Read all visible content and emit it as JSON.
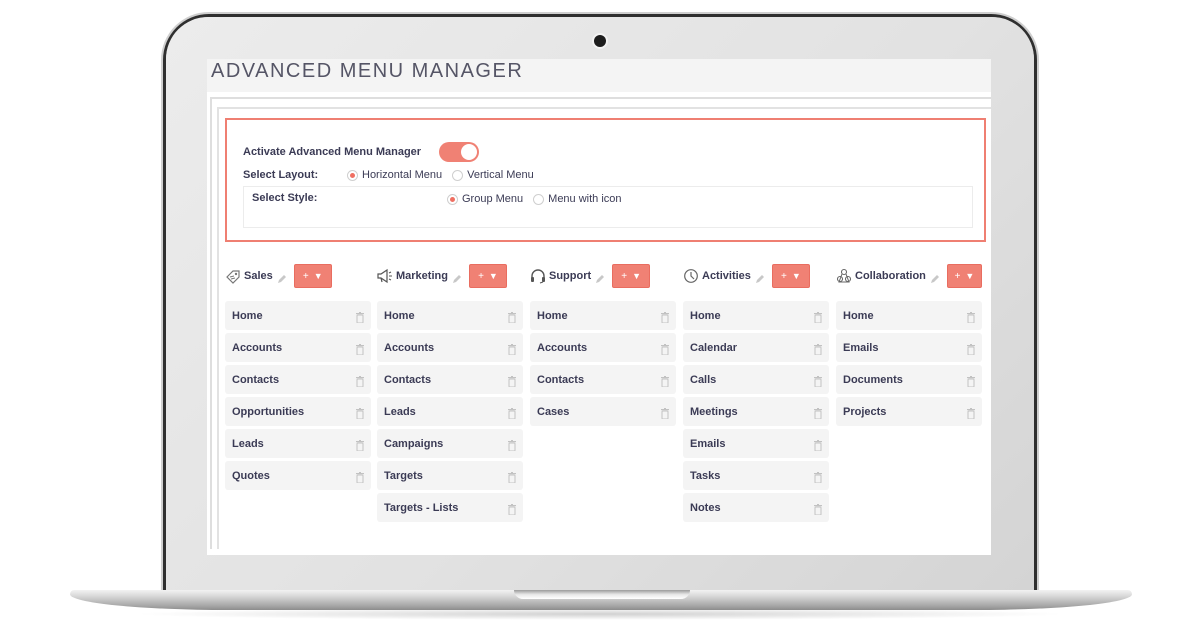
{
  "page": {
    "title": "ADVANCED MENU MANAGER"
  },
  "settings": {
    "activate_label": "Activate Advanced Menu Manager",
    "activate_on": true,
    "layout_label": "Select Layout:",
    "layout_options": [
      "Horizontal Menu",
      "Vertical Menu"
    ],
    "layout_selected": "Horizontal Menu",
    "style_label": "Select Style:",
    "style_options": [
      "Group Menu",
      "Menu with icon"
    ],
    "style_selected": "Group Menu"
  },
  "colors": {
    "accent": "#f08174",
    "text": "#3b3b55",
    "item_bg": "#f4f4f4"
  },
  "groups": [
    {
      "name": "Sales",
      "icon": "tag-icon",
      "add_label": "+",
      "add_caret": "▼",
      "items": [
        "Home",
        "Accounts",
        "Contacts",
        "Opportunities",
        "Leads",
        "Quotes"
      ]
    },
    {
      "name": "Marketing",
      "icon": "megaphone-icon",
      "add_label": "+",
      "add_caret": "▼",
      "items": [
        "Home",
        "Accounts",
        "Contacts",
        "Leads",
        "Campaigns",
        "Targets",
        "Targets - Lists"
      ]
    },
    {
      "name": "Support",
      "icon": "headset-icon",
      "add_label": "+",
      "add_caret": "▼",
      "items": [
        "Home",
        "Accounts",
        "Contacts",
        "Cases"
      ]
    },
    {
      "name": "Activities",
      "icon": "clock-icon",
      "add_label": "+",
      "add_caret": "▼",
      "items": [
        "Home",
        "Calendar",
        "Calls",
        "Meetings",
        "Emails",
        "Tasks",
        "Notes"
      ]
    },
    {
      "name": "Collaboration",
      "icon": "collaboration-icon",
      "add_label": "+",
      "add_caret": "▼",
      "items": [
        "Home",
        "Emails",
        "Documents",
        "Projects"
      ]
    }
  ]
}
